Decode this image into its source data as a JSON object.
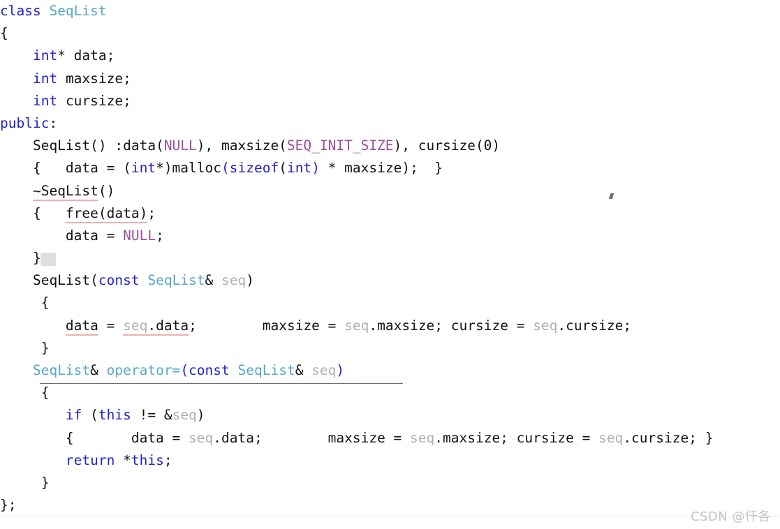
{
  "document": {
    "kind": "code-screenshot",
    "language": "C++",
    "class_name": "SeqList"
  },
  "colors": {
    "background": "#ffffff",
    "keyword": "#2222cc",
    "type": "#56a8c8",
    "macro": "#9b4f9b",
    "plain": "#141414",
    "dimmed": "#b0b0b0",
    "underline_pink": "#efb0b0",
    "underline_grey": "#8a8a8a",
    "watermark": "#c4c4c4"
  },
  "watermark": {
    "text": "CSDN @仟各"
  },
  "code": {
    "lines": [
      {
        "id": "line-1",
        "tokens": [
          {
            "t": "class",
            "c": "kw"
          },
          {
            "t": " ",
            "c": "pln"
          },
          {
            "t": "SeqList",
            "c": "typ"
          }
        ]
      },
      {
        "id": "line-2",
        "tokens": [
          {
            "t": "{",
            "c": "pln"
          }
        ]
      },
      {
        "id": "line-3",
        "tokens": [
          {
            "t": "    ",
            "c": "pln"
          },
          {
            "t": "int",
            "c": "kw"
          },
          {
            "t": "* data;",
            "c": "pln"
          }
        ]
      },
      {
        "id": "line-4",
        "tokens": [
          {
            "t": "    ",
            "c": "pln"
          },
          {
            "t": "int",
            "c": "kw"
          },
          {
            "t": " maxsize;",
            "c": "pln"
          }
        ]
      },
      {
        "id": "line-5",
        "tokens": [
          {
            "t": "    ",
            "c": "pln"
          },
          {
            "t": "int",
            "c": "kw"
          },
          {
            "t": " cursize;",
            "c": "pln"
          }
        ]
      },
      {
        "id": "line-6",
        "tokens": [
          {
            "t": "public",
            "c": "kw"
          },
          {
            "t": ":",
            "c": "pln"
          }
        ]
      },
      {
        "id": "line-7",
        "tokens": [
          {
            "t": "    SeqList() :data(",
            "c": "pln"
          },
          {
            "t": "NULL",
            "c": "mac"
          },
          {
            "t": "), maxsize(",
            "c": "pln"
          },
          {
            "t": "SEQ_INIT_SIZE",
            "c": "mac"
          },
          {
            "t": "), cursize(0)",
            "c": "pln"
          }
        ]
      },
      {
        "id": "line-8",
        "tokens": [
          {
            "t": "    {   data = (",
            "c": "pln"
          },
          {
            "t": "int",
            "c": "kw"
          },
          {
            "t": "*)malloc",
            "c": "pln"
          },
          {
            "t": "(",
            "c": "kw"
          },
          {
            "t": "sizeof",
            "c": "kw"
          },
          {
            "t": "(",
            "c": "pln"
          },
          {
            "t": "int",
            "c": "kw"
          },
          {
            "t": ")",
            "c": "kw"
          },
          {
            "t": " * maxsize);  }",
            "c": "pln"
          }
        ]
      },
      {
        "id": "line-9",
        "tokens": [
          {
            "t": "    ",
            "c": "pln"
          },
          {
            "t": "~SeqList",
            "c": "pln",
            "ul": "pink"
          },
          {
            "t": "()",
            "c": "pln"
          }
        ]
      },
      {
        "id": "line-10",
        "tokens": [
          {
            "t": "    {   ",
            "c": "pln"
          },
          {
            "t": "free(data)",
            "c": "pln",
            "ul": "pink"
          },
          {
            "t": ";",
            "c": "pln"
          }
        ]
      },
      {
        "id": "line-11",
        "tokens": [
          {
            "t": "        data = ",
            "c": "pln"
          },
          {
            "t": "NULL",
            "c": "mac"
          },
          {
            "t": ";",
            "c": "pln"
          }
        ]
      },
      {
        "id": "line-12",
        "tokens": [
          {
            "t": "    }",
            "c": "pln"
          }
        ]
      },
      {
        "id": "line-13",
        "tokens": [
          {
            "t": "    SeqList(",
            "c": "pln"
          },
          {
            "t": "const",
            "c": "kw"
          },
          {
            "t": " ",
            "c": "pln"
          },
          {
            "t": "SeqList",
            "c": "typ"
          },
          {
            "t": "& ",
            "c": "pln"
          },
          {
            "t": "seq",
            "c": "dim"
          },
          {
            "t": ")",
            "c": "pln"
          }
        ]
      },
      {
        "id": "line-14",
        "tokens": [
          {
            "t": "     {",
            "c": "pln"
          }
        ]
      },
      {
        "id": "line-15",
        "tokens": [
          {
            "t": "        ",
            "c": "pln"
          },
          {
            "t": "data",
            "c": "pln",
            "ul": "pink"
          },
          {
            "t": " = ",
            "c": "pln"
          },
          {
            "t": "seq",
            "c": "dim",
            "ul": "pink"
          },
          {
            "t": ".",
            "c": "pln",
            "ul": "pink"
          },
          {
            "t": "data",
            "c": "pln",
            "ul": "pink"
          },
          {
            "t": ";        maxsize = ",
            "c": "pln"
          },
          {
            "t": "seq",
            "c": "dim"
          },
          {
            "t": ".maxsize; cursize = ",
            "c": "pln"
          },
          {
            "t": "seq",
            "c": "dim"
          },
          {
            "t": ".cursize;",
            "c": "pln"
          }
        ]
      },
      {
        "id": "line-16",
        "tokens": [
          {
            "t": "     }",
            "c": "pln"
          }
        ]
      },
      {
        "id": "line-17",
        "tokens": [
          {
            "t": "    ",
            "c": "pln"
          },
          {
            "t": "SeqList",
            "c": "typ"
          },
          {
            "t": "& ",
            "c": "pln"
          },
          {
            "t": "operator=",
            "c": "typ"
          },
          {
            "t": "(",
            "c": "kw"
          },
          {
            "t": "const",
            "c": "kw"
          },
          {
            "t": " ",
            "c": "pln"
          },
          {
            "t": "SeqList",
            "c": "typ"
          },
          {
            "t": "& ",
            "c": "pln"
          },
          {
            "t": "seq",
            "c": "dim"
          },
          {
            "t": ")",
            "c": "kw"
          }
        ]
      },
      {
        "id": "line-18",
        "tokens": [
          {
            "t": "     {",
            "c": "pln"
          }
        ]
      },
      {
        "id": "line-19",
        "tokens": [
          {
            "t": "        ",
            "c": "pln"
          },
          {
            "t": "if",
            "c": "kw"
          },
          {
            "t": " (",
            "c": "pln"
          },
          {
            "t": "this",
            "c": "kw"
          },
          {
            "t": " != &",
            "c": "pln"
          },
          {
            "t": "seq",
            "c": "dim"
          },
          {
            "t": ")",
            "c": "pln"
          }
        ]
      },
      {
        "id": "line-20",
        "tokens": [
          {
            "t": "        {       data = ",
            "c": "pln"
          },
          {
            "t": "seq",
            "c": "dim"
          },
          {
            "t": ".data;        maxsize = ",
            "c": "pln"
          },
          {
            "t": "seq",
            "c": "dim"
          },
          {
            "t": ".maxsize; cursize = ",
            "c": "pln"
          },
          {
            "t": "seq",
            "c": "dim"
          },
          {
            "t": ".cursize; }",
            "c": "pln"
          }
        ]
      },
      {
        "id": "line-21",
        "tokens": [
          {
            "t": "        ",
            "c": "pln"
          },
          {
            "t": "return",
            "c": "kw"
          },
          {
            "t": " *",
            "c": "pln"
          },
          {
            "t": "this",
            "c": "kw"
          },
          {
            "t": ";",
            "c": "pln"
          }
        ]
      },
      {
        "id": "line-22",
        "tokens": [
          {
            "t": "     }",
            "c": "pln"
          }
        ]
      },
      {
        "id": "line-23",
        "tokens": [
          {
            "t": "};",
            "c": "pln"
          }
        ]
      }
    ]
  }
}
